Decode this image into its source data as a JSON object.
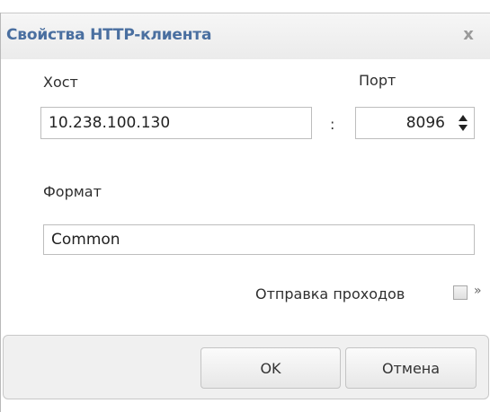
{
  "dialog": {
    "title": "Свойства HTTP-клиента",
    "close_glyph": "x"
  },
  "form": {
    "host_label": "Хост",
    "host_value": "10.238.100.130",
    "colon": ":",
    "port_label": "Порт",
    "port_value": "8096",
    "format_label": "Формат",
    "format_value": "Common",
    "send_passes_label": "Отправка проходов",
    "send_passes_checked": false,
    "expand_glyph": "»"
  },
  "buttons": {
    "ok_label": "OK",
    "cancel_label": "Отмена"
  },
  "colors": {
    "title_color": "#4a6fa0",
    "dialog_bg": "#f2f2f2",
    "content_bg": "#ffffff"
  }
}
